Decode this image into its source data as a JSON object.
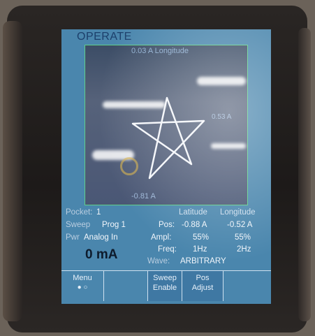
{
  "screen": {
    "title": "OPERATE",
    "plot": {
      "top_label": "0.03 A  Longitude",
      "mid_label": "0.53 A",
      "bottom_label": "-0.81 A"
    },
    "status": {
      "pocket_label": "Pocket:",
      "pocket_value": "1",
      "sweep_label": "Sweep",
      "sweep_value": "Prog 1",
      "pwr_label": "Pwr",
      "pwr_value": "Analog In",
      "current": "0 mA"
    },
    "axes": {
      "col1": "Latitude",
      "col2": "Longitude"
    },
    "rows": [
      {
        "label": "Pos:",
        "lat": "-0.88 A",
        "lon": "-0.52 A"
      },
      {
        "label": "Ampl:",
        "lat": "55%",
        "lon": "55%"
      },
      {
        "label": "Freq:",
        "lat": "1Hz",
        "lon": "2Hz"
      }
    ],
    "wave": {
      "label": "Wave:",
      "value": "ARBITRARY"
    },
    "softkeys": {
      "menu": "Menu",
      "menu_dots": "● ○",
      "sweep_enable_1": "Sweep",
      "sweep_enable_2": "Enable",
      "pos_adjust_1": "Pos",
      "pos_adjust_2": "Adjust"
    }
  },
  "colors": {
    "screen_bg": "#4a86ad",
    "plot_border": "#5fd08a",
    "trace": "#f4f6fa"
  }
}
